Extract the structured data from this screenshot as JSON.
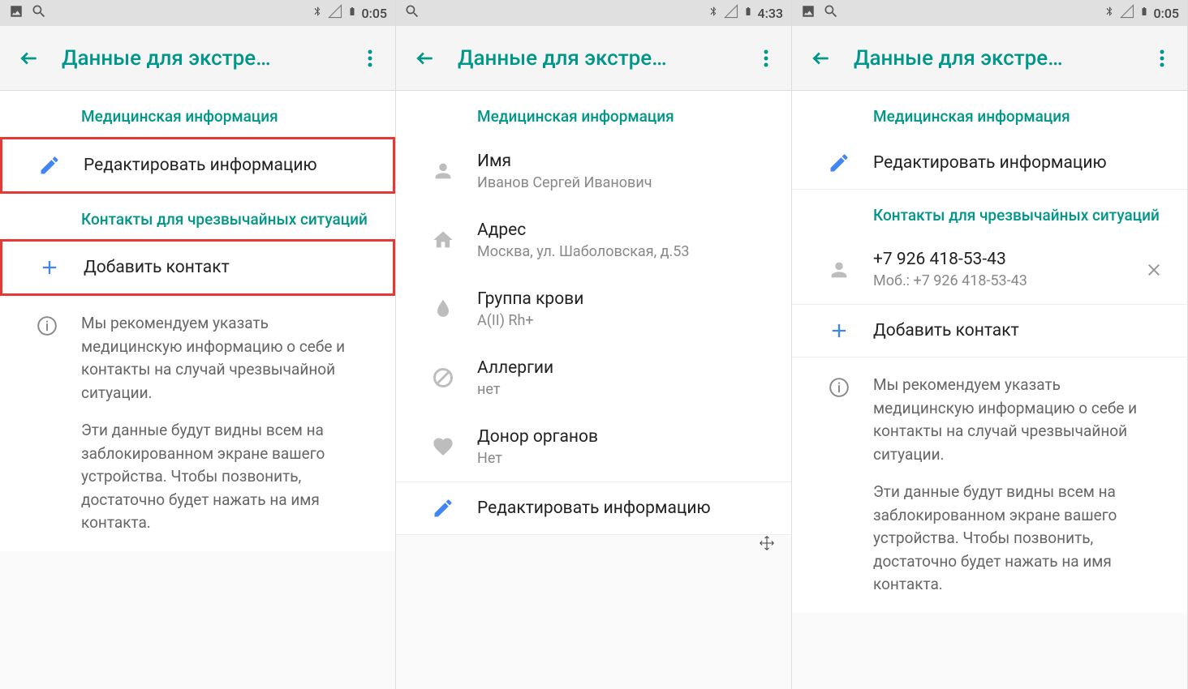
{
  "app_title": "Данные для экстре…",
  "screens": [
    {
      "status": {
        "time": "0:05",
        "show_image_icon": true
      },
      "sections": [
        {
          "header": "Медицинская информация",
          "items": [
            {
              "icon": "pencil",
              "primary": "Редактировать информацию",
              "interactable": true,
              "highlight": true
            }
          ]
        },
        {
          "header": "Контакты для чрезвычайных ситуаций",
          "items": [
            {
              "icon": "plus",
              "primary": "Добавить контакт",
              "interactable": true,
              "highlight": true
            }
          ]
        }
      ],
      "info": {
        "p1": "Мы рекомендуем указать медицинскую информацию о себе и контакты на случай чрезвычайной ситуации.",
        "p2": "Эти данные будут видны всем на заблокированном экране вашего устройства. Чтобы позвонить, достаточно будет нажать на имя контакта."
      }
    },
    {
      "status": {
        "time": "4:33",
        "show_image_icon": false
      },
      "sections": [
        {
          "header": "Медицинская информация",
          "items": [
            {
              "icon": "person",
              "primary": "Имя",
              "secondary": "Иванов Сергей Иванович"
            },
            {
              "icon": "home",
              "primary": "Адрес",
              "secondary": "Москва, ул. Шаболовская,  д.53"
            },
            {
              "icon": "drop",
              "primary": "Группа крови",
              "secondary": "A(II) Rh+"
            },
            {
              "icon": "slash",
              "primary": "Аллергии",
              "secondary": "нет"
            },
            {
              "icon": "heart",
              "primary": "Донор органов",
              "secondary": "Нет"
            },
            {
              "icon": "pencil",
              "primary": "Редактировать информацию",
              "interactable": true,
              "border_top": true
            }
          ]
        }
      ]
    },
    {
      "status": {
        "time": "0:05",
        "show_image_icon": true
      },
      "sections": [
        {
          "header": "Медицинская информация",
          "items": [
            {
              "icon": "pencil",
              "primary": "Редактировать информацию",
              "interactable": true,
              "bordered": true
            }
          ]
        },
        {
          "header": "Контакты для чрезвычайных ситуаций",
          "items": [
            {
              "icon": "person",
              "primary": "+7 926 418-53-43",
              "secondary": "Моб.: +7 926 418-53-43",
              "trailing": "close",
              "interactable": true
            },
            {
              "icon": "plus",
              "primary": "Добавить контакт",
              "interactable": true,
              "bordered": true
            }
          ]
        }
      ],
      "info": {
        "p1": "Мы рекомендуем указать медицинскую информацию о себе и контакты на случай чрезвычайной ситуации.",
        "p2": "Эти данные будут видны всем на заблокированном экране вашего устройства. Чтобы позвонить, достаточно будет нажать на имя контакта."
      }
    }
  ]
}
